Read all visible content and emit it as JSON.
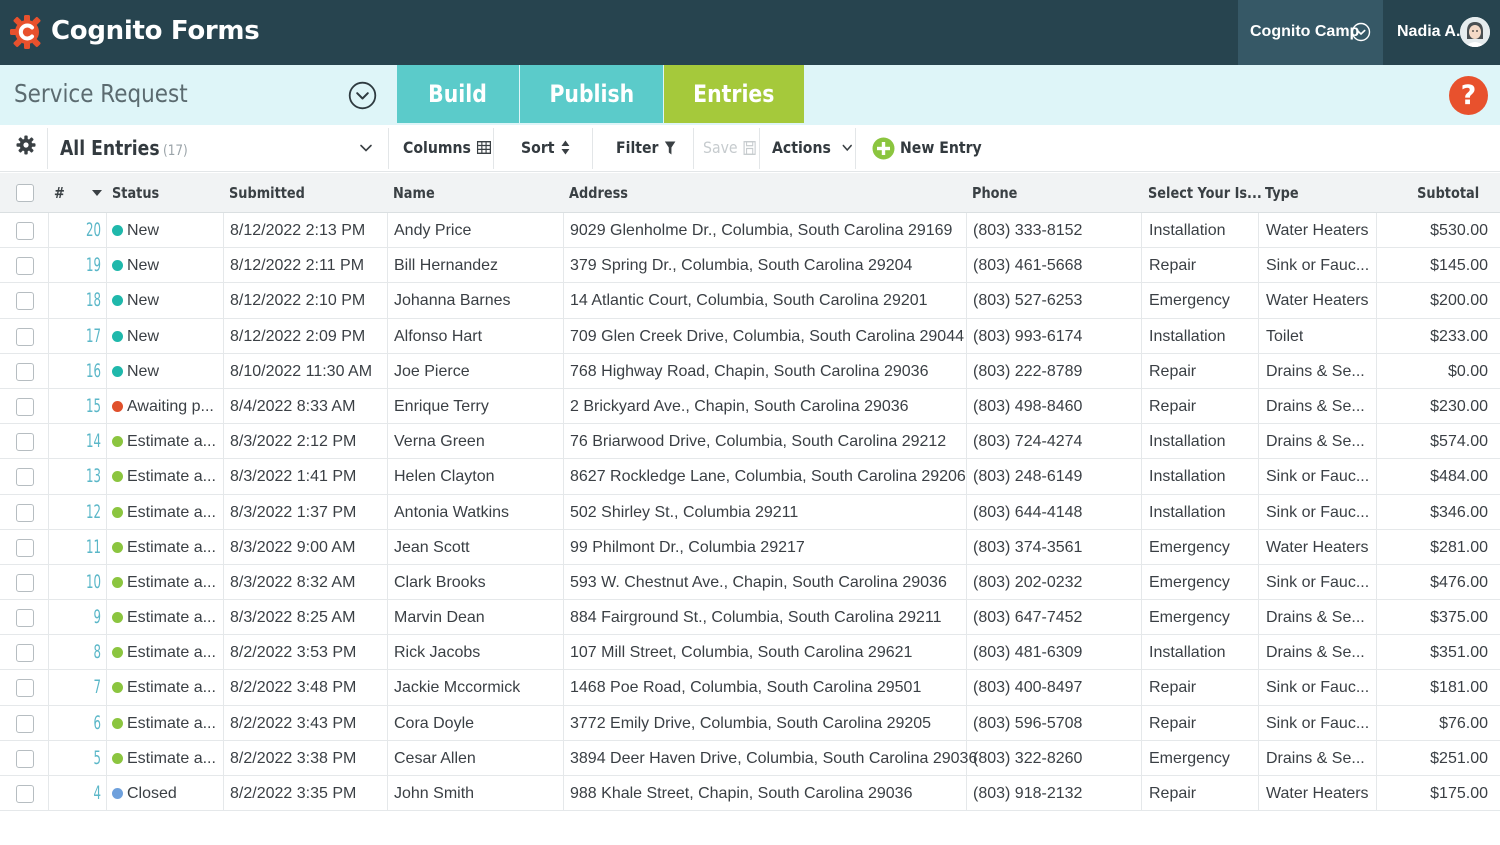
{
  "app": {
    "brand": "Cognito Forms",
    "organization": "Cognito Camp",
    "user": "Nadia A."
  },
  "form": {
    "title": "Service Request",
    "tabs": [
      "Build",
      "Publish",
      "Entries"
    ],
    "active_tab": "Entries",
    "help_label": "?"
  },
  "toolbar": {
    "view": "All Entries",
    "view_count": "(17)",
    "columns": "Columns",
    "sort": "Sort",
    "filter": "Filter",
    "save": "Save",
    "actions": "Actions",
    "new_entry": "New Entry"
  },
  "colors": {
    "New": "#1fb8ab",
    "Awaiting p...": "#e0502b",
    "Estimate a...": "#8bc53f",
    "Closed": "#6ea0dc"
  },
  "table": {
    "headers": {
      "num": "#",
      "status": "Status",
      "submitted": "Submitted",
      "name": "Name",
      "address": "Address",
      "phone": "Phone",
      "select": "Select Your Is...",
      "type": "Type",
      "subtotal": "Subtotal"
    },
    "rows": [
      {
        "num": "20",
        "status": "New",
        "submitted": "8/12/2022 2:13 PM",
        "name": "Andy Price",
        "address": "9029 Glenholme Dr., Columbia, South Carolina 29169",
        "phone": "(803) 333-8152",
        "select": "Installation",
        "type": "Water Heaters",
        "subtotal": "$530.00"
      },
      {
        "num": "19",
        "status": "New",
        "submitted": "8/12/2022 2:11 PM",
        "name": "Bill Hernandez",
        "address": "379 Spring Dr., Columbia, South Carolina 29204",
        "phone": "(803) 461-5668",
        "select": "Repair",
        "type": "Sink or Fauc...",
        "subtotal": "$145.00"
      },
      {
        "num": "18",
        "status": "New",
        "submitted": "8/12/2022 2:10 PM",
        "name": "Johanna Barnes",
        "address": "14 Atlantic Court, Columbia, South Carolina 29201",
        "phone": "(803) 527-6253",
        "select": "Emergency",
        "type": "Water Heaters",
        "subtotal": "$200.00"
      },
      {
        "num": "17",
        "status": "New",
        "submitted": "8/12/2022 2:09 PM",
        "name": "Alfonso Hart",
        "address": "709 Glen Creek Drive, Columbia, South Carolina 29044",
        "phone": "(803) 993-6174",
        "select": "Installation",
        "type": "Toilet",
        "subtotal": "$233.00"
      },
      {
        "num": "16",
        "status": "New",
        "submitted": "8/10/2022 11:30 AM",
        "name": "Joe Pierce",
        "address": "768 Highway Road, Chapin, South Carolina 29036",
        "phone": "(803) 222-8789",
        "select": "Repair",
        "type": "Drains & Se...",
        "subtotal": "$0.00"
      },
      {
        "num": "15",
        "status": "Awaiting p...",
        "submitted": "8/4/2022 8:33 AM",
        "name": "Enrique Terry",
        "address": "2 Brickyard Ave., Chapin, South Carolina 29036",
        "phone": "(803) 498-8460",
        "select": "Repair",
        "type": "Drains & Se...",
        "subtotal": "$230.00"
      },
      {
        "num": "14",
        "status": "Estimate a...",
        "submitted": "8/3/2022 2:12 PM",
        "name": "Verna Green",
        "address": "76 Briarwood Drive, Columbia, South Carolina 29212",
        "phone": "(803) 724-4274",
        "select": "Installation",
        "type": "Drains & Se...",
        "subtotal": "$574.00"
      },
      {
        "num": "13",
        "status": "Estimate a...",
        "submitted": "8/3/2022 1:41 PM",
        "name": "Helen Clayton",
        "address": "8627 Rockledge Lane, Columbia, South Carolina 29206",
        "phone": "(803) 248-6149",
        "select": "Installation",
        "type": "Sink or Fauc...",
        "subtotal": "$484.00"
      },
      {
        "num": "12",
        "status": "Estimate a...",
        "submitted": "8/3/2022 1:37 PM",
        "name": "Antonia Watkins",
        "address": "502 Shirley St., Columbia 29211",
        "phone": "(803) 644-4148",
        "select": "Installation",
        "type": "Sink or Fauc...",
        "subtotal": "$346.00"
      },
      {
        "num": "11",
        "status": "Estimate a...",
        "submitted": "8/3/2022 9:00 AM",
        "name": "Jean Scott",
        "address": "99 Philmont Dr., Columbia 29217",
        "phone": "(803) 374-3561",
        "select": "Emergency",
        "type": "Water Heaters",
        "subtotal": "$281.00"
      },
      {
        "num": "10",
        "status": "Estimate a...",
        "submitted": "8/3/2022 8:32 AM",
        "name": "Clark Brooks",
        "address": "593 W. Chestnut Ave., Chapin, South Carolina 29036",
        "phone": "(803) 202-0232",
        "select": "Emergency",
        "type": "Sink or Fauc...",
        "subtotal": "$476.00"
      },
      {
        "num": "9",
        "status": "Estimate a...",
        "submitted": "8/3/2022 8:25 AM",
        "name": "Marvin Dean",
        "address": "884 Fairground St., Columbia, South Carolina 29211",
        "phone": "(803) 647-7452",
        "select": "Emergency",
        "type": "Drains & Se...",
        "subtotal": "$375.00"
      },
      {
        "num": "8",
        "status": "Estimate a...",
        "submitted": "8/2/2022 3:53 PM",
        "name": "Rick Jacobs",
        "address": "107 Mill Street, Columbia, South Carolina 29621",
        "phone": "(803) 481-6309",
        "select": "Installation",
        "type": "Drains & Se...",
        "subtotal": "$351.00"
      },
      {
        "num": "7",
        "status": "Estimate a...",
        "submitted": "8/2/2022 3:48 PM",
        "name": "Jackie Mccormick",
        "address": "1468 Poe Road, Columbia, South Carolina 29501",
        "phone": "(803) 400-8497",
        "select": "Repair",
        "type": "Sink or Fauc...",
        "subtotal": "$181.00"
      },
      {
        "num": "6",
        "status": "Estimate a...",
        "submitted": "8/2/2022 3:43 PM",
        "name": "Cora Doyle",
        "address": "3772 Emily Drive, Columbia, South Carolina 29205",
        "phone": "(803) 596-5708",
        "select": "Repair",
        "type": "Sink or Fauc...",
        "subtotal": "$76.00"
      },
      {
        "num": "5",
        "status": "Estimate a...",
        "submitted": "8/2/2022 3:38 PM",
        "name": "Cesar Allen",
        "address": "3894 Deer Haven Drive, Columbia, South Carolina 29036",
        "phone": "(803) 322-8260",
        "select": "Emergency",
        "type": "Drains & Se...",
        "subtotal": "$251.00"
      },
      {
        "num": "4",
        "status": "Closed",
        "submitted": "8/2/2022 3:35 PM",
        "name": "John Smith",
        "address": "988 Khale Street, Chapin, South Carolina 29036",
        "phone": "(803) 918-2132",
        "select": "Repair",
        "type": "Water Heaters",
        "subtotal": "$175.00"
      }
    ]
  }
}
